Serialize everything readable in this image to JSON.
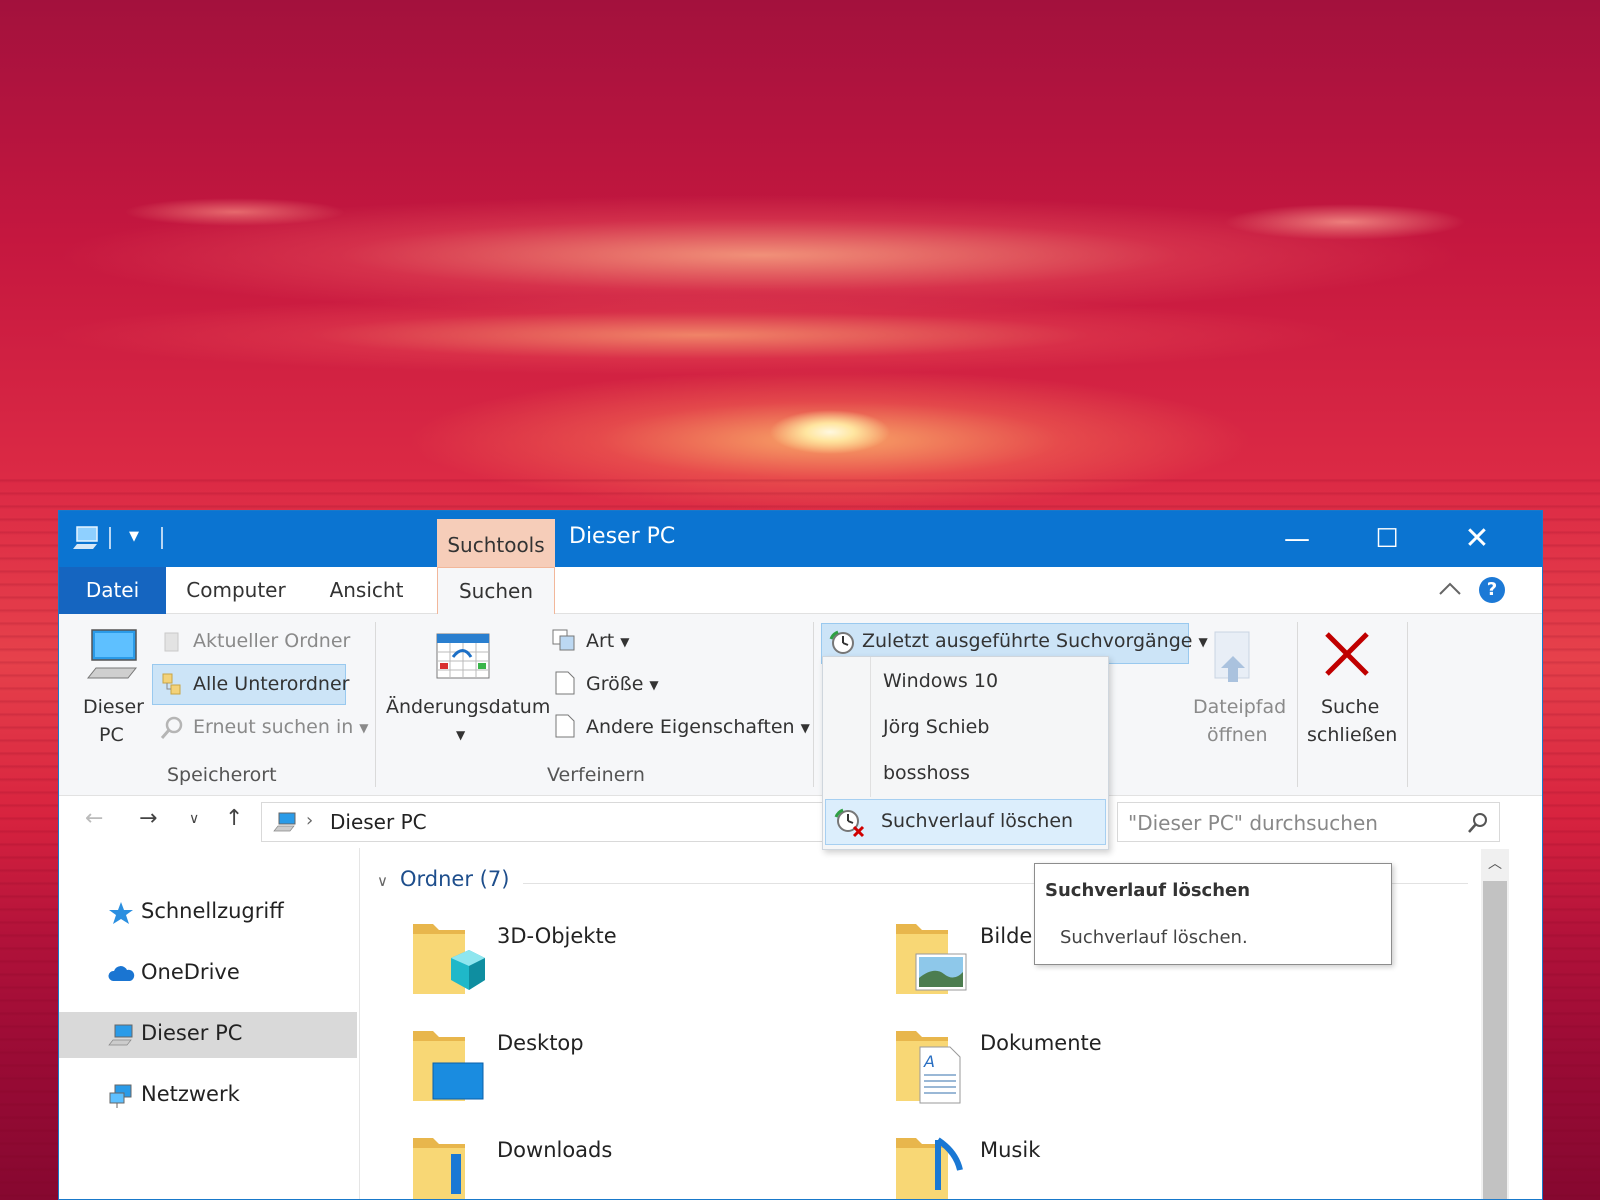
{
  "window": {
    "title": "Dieser PC",
    "context_tab": "Suchtools"
  },
  "tabs": {
    "datei": "Datei",
    "computer": "Computer",
    "ansicht": "Ansicht",
    "suchen": "Suchen"
  },
  "ribbon": {
    "speicherort": {
      "label": "Speicherort",
      "dieser_pc_line1": "Dieser",
      "dieser_pc_line2": "PC",
      "aktueller_ordner": "Aktueller Ordner",
      "alle_unterordner": "Alle Unterordner",
      "erneut_suchen": "Erneut suchen in"
    },
    "verfeinern": {
      "label": "Verfeinern",
      "aenderungsdatum": "Änderungsdatum",
      "art": "Art",
      "groesse": "Größe",
      "andere": "Andere Eigenschaften"
    },
    "recent_searches": "Zuletzt ausgeführte Suchvorgänge",
    "dateipfad_line1": "Dateipfad",
    "dateipfad_line2": "öffnen",
    "suche_schliessen_line1": "Suche",
    "suche_schliessen_line2": "schließen"
  },
  "dropdown": {
    "items": [
      "Windows 10",
      "Jörg Schieb",
      "bosshoss"
    ],
    "clear": "Suchverlauf löschen"
  },
  "address": {
    "path": "Dieser PC",
    "search_placeholder": "\"Dieser PC\" durchsuchen"
  },
  "nav": {
    "items": [
      "Schnellzugriff",
      "OneDrive",
      "Dieser PC",
      "Netzwerk"
    ],
    "selected": "Dieser PC"
  },
  "content": {
    "section_header": "Ordner (7)",
    "folders": [
      "3D-Objekte",
      "Bilde",
      "Desktop",
      "Dokumente",
      "Downloads",
      "Musik"
    ]
  },
  "tooltip": {
    "title": "Suchverlauf löschen",
    "body": "Suchverlauf löschen."
  },
  "colors": {
    "titlebar": "#0b74d1",
    "context_tab": "#f6cdb9",
    "selection": "#cce4f7",
    "close_red": "#c00000"
  }
}
